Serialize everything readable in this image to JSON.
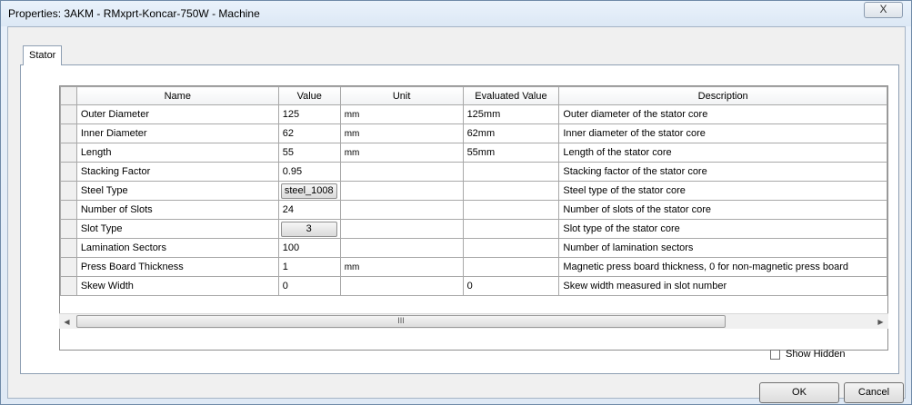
{
  "window": {
    "title": "Properties: 3AKM - RMxprt-Koncar-750W - Machine",
    "close_label": "X"
  },
  "tabs": [
    {
      "label": "Stator"
    }
  ],
  "grid": {
    "columns": [
      "Name",
      "Value",
      "Unit",
      "Evaluated Value",
      "Description"
    ],
    "rows": [
      {
        "name": "Outer Diameter",
        "value": "125",
        "unit": "mm",
        "evaluated": "125mm",
        "description": "Outer diameter of the stator core"
      },
      {
        "name": "Inner Diameter",
        "value": "62",
        "unit": "mm",
        "evaluated": "62mm",
        "description": "Inner diameter of the stator core"
      },
      {
        "name": "Length",
        "value": "55",
        "unit": "mm",
        "evaluated": "55mm",
        "description": "Length of the stator core"
      },
      {
        "name": "Stacking Factor",
        "value": "0.95",
        "unit": "",
        "evaluated": "",
        "description": "Stacking factor of the stator core"
      },
      {
        "name": "Steel Type",
        "value": "steel_1008",
        "unit": "",
        "evaluated": "",
        "description": "Steel type of the stator core"
      },
      {
        "name": "Number of Slots",
        "value": "24",
        "unit": "",
        "evaluated": "",
        "description": "Number of slots of the stator core"
      },
      {
        "name": "Slot Type",
        "value": "3",
        "unit": "",
        "evaluated": "",
        "description": "Slot type of the stator core"
      },
      {
        "name": "Lamination Sectors",
        "value": "100",
        "unit": "",
        "evaluated": "",
        "description": "Number of lamination sectors"
      },
      {
        "name": "Press Board Thickness",
        "value": "1",
        "unit": "mm",
        "evaluated": "",
        "description": "Magnetic press board thickness, 0 for non-magnetic press board"
      },
      {
        "name": "Skew Width",
        "value": "0",
        "unit": "",
        "evaluated": "0",
        "description": "Skew width measured in slot number"
      }
    ]
  },
  "scrollbar": {
    "thumb_grip": "III",
    "left_arrow": "◀",
    "right_arrow": "▶"
  },
  "show_hidden_label": "Show Hidden",
  "buttons": {
    "ok": "OK",
    "cancel": "Cancel"
  }
}
